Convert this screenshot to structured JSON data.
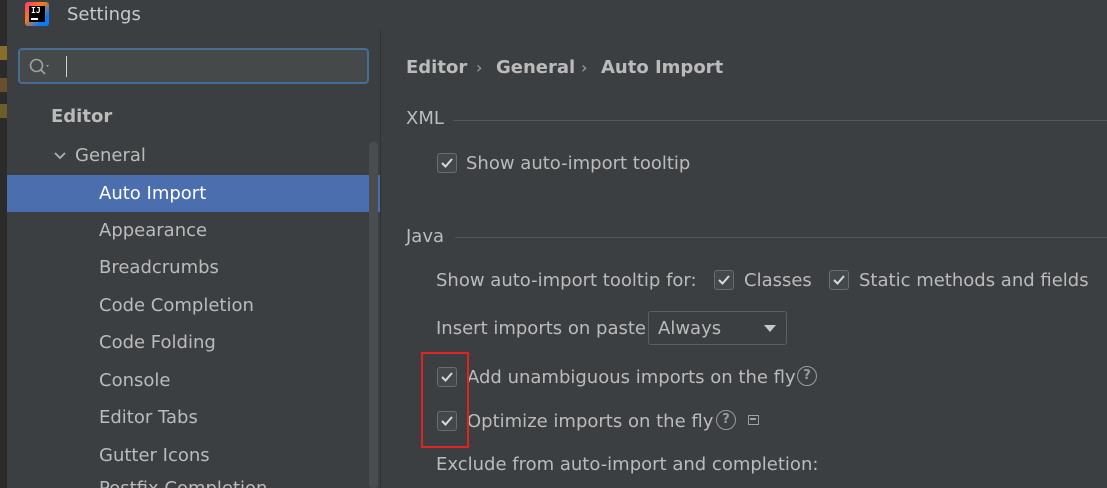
{
  "window": {
    "title": "Settings"
  },
  "search": {
    "value": "",
    "placeholder": ""
  },
  "tree": {
    "root": "Editor",
    "group": "General",
    "items": [
      "Auto Import",
      "Appearance",
      "Breadcrumbs",
      "Code Completion",
      "Code Folding",
      "Console",
      "Editor Tabs",
      "Gutter Icons",
      "Postfix Completion"
    ],
    "selected": "Auto Import"
  },
  "breadcrumb": [
    "Editor",
    "General",
    "Auto Import"
  ],
  "xml_section": {
    "title": "XML",
    "show_tooltip": {
      "label": "Show auto-import tooltip",
      "checked": true
    }
  },
  "java_section": {
    "title": "Java",
    "tooltip_for_label": "Show auto-import tooltip for:",
    "classes": {
      "label": "Classes",
      "checked": true
    },
    "static_methods": {
      "label": "Static methods and fields",
      "checked": true
    },
    "insert_on_paste_label": "Insert imports on paste:",
    "insert_on_paste_value": "Always",
    "add_unambiguous": {
      "label": "Add unambiguous imports on the fly",
      "checked": true
    },
    "optimize": {
      "label": "Optimize imports on the fly",
      "checked": true
    },
    "exclude_label": "Exclude from auto-import and completion:"
  },
  "colors": {
    "selection": "#4b6eaf",
    "annotation": "#e02424",
    "background": "#3c3f41"
  }
}
